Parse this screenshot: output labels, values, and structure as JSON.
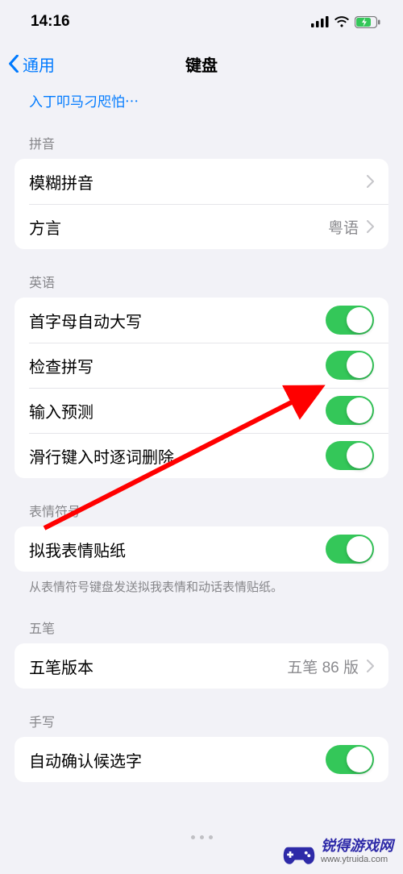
{
  "status": {
    "time": "14:16"
  },
  "nav": {
    "back_label": "通用",
    "title": "键盘"
  },
  "truncated_link": "入丁叩马刁咫怕⋯",
  "sections": {
    "pinyin": {
      "header": "拼音",
      "rows": {
        "fuzzy": {
          "label": "模糊拼音"
        },
        "dialect": {
          "label": "方言",
          "value": "粤语"
        }
      }
    },
    "english": {
      "header": "英语",
      "rows": {
        "autocap": {
          "label": "首字母自动大写"
        },
        "spellcheck": {
          "label": "检查拼写"
        },
        "predictive": {
          "label": "输入预测"
        },
        "slide_delete": {
          "label": "滑行键入时逐词删除"
        }
      }
    },
    "emoji": {
      "header": "表情符号",
      "rows": {
        "memoji": {
          "label": "拟我表情贴纸"
        }
      },
      "footer": "从表情符号键盘发送拟我表情和动话表情贴纸。"
    },
    "wubi": {
      "header": "五笔",
      "rows": {
        "version": {
          "label": "五笔版本",
          "value": "五笔 86 版"
        }
      }
    },
    "handwriting": {
      "header": "手写",
      "rows": {
        "auto_confirm": {
          "label": "自动确认候选字"
        }
      }
    }
  },
  "watermark": {
    "name": "锐得游戏网",
    "url": "www.ytruida.com"
  }
}
